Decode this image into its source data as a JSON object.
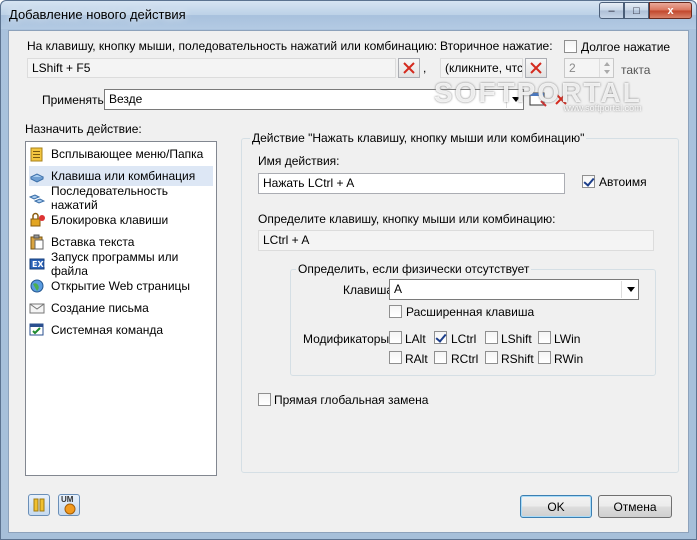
{
  "window": {
    "title": "Добавление нового действия",
    "minimize_glyph": "–",
    "maximize_glyph": "□",
    "close_glyph": "x"
  },
  "trigger": {
    "label": "На клавишу, кнопку мыши, поледовательность нажатий или комбинацию:",
    "value": "LShift + F5",
    "separator": ",",
    "secondary_label": "Вторичное нажатие:",
    "secondary_value": "(кликните, чтс",
    "long_press_label": "Долгое нажатие",
    "long_press_checked": false,
    "ticks_value": "2",
    "ticks_label": "такта"
  },
  "apply": {
    "label": "Применять",
    "value": "Везде"
  },
  "watermark": {
    "brand": "SOFTPORTAL",
    "url": "www.softportal.com"
  },
  "assign": {
    "label": "Назначить действие:",
    "items": [
      {
        "label": "Всплывающее меню/Папка",
        "icon": "menu-folder-icon"
      },
      {
        "label": "Клавиша или комбинация",
        "icon": "keyboard-icon",
        "selected": true
      },
      {
        "label": "Последовательность нажатий",
        "icon": "key-sequence-icon"
      },
      {
        "label": "Блокировка клавиши",
        "icon": "key-lock-icon"
      },
      {
        "label": "Вставка текста",
        "icon": "paste-text-icon"
      },
      {
        "label": "Запуск программы или файла",
        "icon": "run-program-icon"
      },
      {
        "label": "Открытие Web страницы",
        "icon": "globe-icon"
      },
      {
        "label": "Создание письма",
        "icon": "envelope-icon"
      },
      {
        "label": "Системная команда",
        "icon": "system-command-icon"
      }
    ]
  },
  "action": {
    "group_title": "Действие \"Нажать клавишу, кнопку мыши или комбинацию\"",
    "name_label": "Имя действия:",
    "name_value": "Нажать LCtrl + A",
    "autoname_label": "Автоимя",
    "autoname_checked": true,
    "define_label": "Определите клавишу, кнопку мыши или комбинацию:",
    "define_value": "LCtrl + A",
    "physical_title": "Определить, если физически отсутствует",
    "key_label": "Клавиша",
    "key_value": "A",
    "extended_label": "Расширенная клавиша",
    "extended_checked": false,
    "modifiers_label": "Модификаторы",
    "modifiers": {
      "lalt": {
        "label": "LAlt",
        "checked": false
      },
      "lctrl": {
        "label": "LCtrl",
        "checked": true
      },
      "lshift": {
        "label": "LShift",
        "checked": false
      },
      "lwin": {
        "label": "LWin",
        "checked": false
      },
      "ralt": {
        "label": "RAlt",
        "checked": false
      },
      "rctrl": {
        "label": "RCtrl",
        "checked": false
      },
      "rshift": {
        "label": "RShift",
        "checked": false
      },
      "rwin": {
        "label": "RWin",
        "checked": false
      }
    },
    "direct_replace_label": "Прямая глобальная замена",
    "direct_replace_checked": false
  },
  "buttons": {
    "ok": "OK",
    "cancel": "Отмена",
    "um_badge": "UM"
  },
  "colors": {
    "accent": "#3c7fb1",
    "delete_x": "#d42a1e",
    "selection": "#dde7f5"
  }
}
